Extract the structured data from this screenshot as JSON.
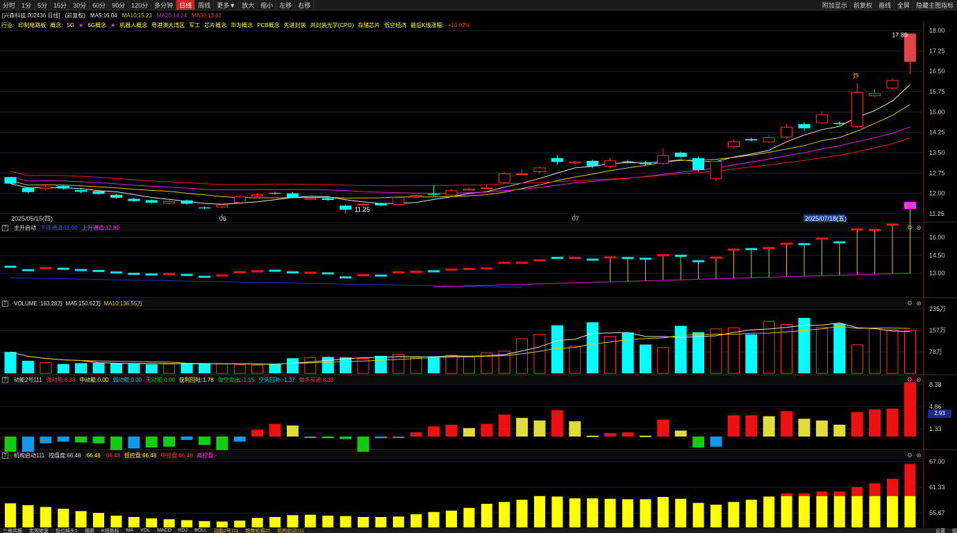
{
  "toolbar": {
    "periods": [
      "分时",
      "1分",
      "5分",
      "15分",
      "30分",
      "60分",
      "90分",
      "120分",
      "多分钟",
      "日线",
      "周线",
      "更多▼",
      "放大",
      "缩小",
      "左移",
      "右移"
    ],
    "active_period": "日线",
    "right_buttons": [
      "附加显示",
      "前复权",
      "画线",
      "全屏",
      "隐藏主图指标"
    ]
  },
  "header": {
    "stock": "[兴森科技 002436 日线]",
    "adjust": "(前复权)",
    "ma5": "MA5:16.04",
    "ma10": "MA10:15.23",
    "ma20": "MA20:14.24",
    "ma30": "MA30:13.61"
  },
  "concepts": {
    "prefix": "行业:",
    "items": [
      {
        "text": "印制电路板",
        "star": false
      },
      {
        "text": "概念:",
        "star": false
      },
      {
        "text": "5G",
        "star": true
      },
      {
        "text": "6G概念",
        "star": true
      },
      {
        "text": "机器人概念",
        "star": false
      },
      {
        "text": "粤港澳大湾区",
        "star": false
      },
      {
        "text": "军工",
        "star": false
      },
      {
        "text": "芯片概念",
        "star": false
      },
      {
        "text": "华为概念",
        "star": false
      },
      {
        "text": "PCB概念",
        "star": false
      },
      {
        "text": "先进封装",
        "star": false
      },
      {
        "text": "共封装光学(CPO)",
        "star": false
      },
      {
        "text": "存储芯片",
        "star": false
      },
      {
        "text": "低空经济",
        "star": false
      },
      {
        "text": "最后K线涨幅:",
        "star": false
      }
    ],
    "last_change": "+10.02%"
  },
  "colors": {
    "up": "#ff3333",
    "down": "#00ffff",
    "ma5": "#e6e6e6",
    "ma10": "#e6c41e",
    "ma20": "#dd22dd",
    "ma30": "#dd1f1f",
    "grid": "#1f1f3a",
    "axis": "#8a1f1f"
  },
  "main_chart": {
    "high_label": "17.89",
    "low_label": "11.25",
    "marker": "炸",
    "y_ticks": [
      "18.00",
      "17.25",
      "16.50",
      "15.75",
      "15.00",
      "14.25",
      "13.50",
      "12.75",
      "12.00",
      "11.25"
    ],
    "x_labels": [
      "2025/05/15(四)",
      "06",
      "07",
      "2025/07/18(五)"
    ],
    "candles": [
      [
        12.6,
        12.36,
        12.36,
        12.6
      ],
      [
        12.2,
        12.05,
        12.22,
        12.0
      ],
      [
        12.18,
        12.24,
        12.3,
        12.12
      ],
      [
        12.27,
        12.18,
        12.3,
        12.12
      ],
      [
        12.12,
        12.06,
        12.2,
        12.0
      ],
      [
        12.08,
        11.98,
        12.1,
        11.95
      ],
      [
        11.95,
        11.84,
        11.98,
        11.8
      ],
      [
        11.8,
        11.72,
        11.84,
        11.68
      ],
      [
        11.75,
        11.66,
        11.78,
        11.62
      ],
      [
        11.64,
        11.7,
        11.74,
        11.6
      ],
      [
        11.74,
        11.62,
        11.78,
        11.58
      ],
      [
        11.48,
        11.45,
        11.52,
        11.42
      ],
      [
        11.5,
        11.57,
        11.62,
        11.46
      ],
      [
        11.66,
        11.87,
        11.92,
        11.6
      ],
      [
        11.9,
        11.95,
        12.02,
        11.86
      ],
      [
        12.02,
        12.0,
        12.06,
        11.95
      ],
      [
        12.0,
        11.85,
        12.05,
        11.82
      ],
      [
        11.78,
        11.82,
        11.86,
        11.74
      ],
      [
        11.82,
        11.76,
        11.86,
        11.72
      ],
      [
        11.55,
        11.4,
        11.58,
        11.25
      ],
      [
        11.58,
        11.6,
        11.64,
        11.5
      ],
      [
        11.64,
        11.56,
        11.66,
        11.52
      ],
      [
        11.6,
        11.85,
        11.88,
        11.56
      ],
      [
        11.88,
        11.92,
        11.96,
        11.84
      ],
      [
        11.98,
        11.95,
        12.3,
        11.9
      ],
      [
        11.94,
        12.1,
        12.18,
        11.9
      ],
      [
        12.12,
        12.16,
        12.2,
        12.08
      ],
      [
        12.2,
        12.2,
        12.3,
        12.15
      ],
      [
        12.4,
        12.72,
        12.8,
        12.35
      ],
      [
        12.72,
        12.72,
        12.9,
        12.7
      ],
      [
        12.8,
        12.94,
        13.0,
        12.75
      ],
      [
        13.3,
        13.16,
        13.42,
        13.05
      ],
      [
        13.12,
        13.16,
        13.2,
        13.05
      ],
      [
        13.2,
        13.0,
        13.24,
        12.92
      ],
      [
        13.0,
        13.2,
        13.3,
        12.92
      ],
      [
        13.18,
        13.15,
        13.24,
        13.1
      ],
      [
        13.14,
        13.08,
        13.2,
        13.02
      ],
      [
        13.1,
        13.4,
        13.65,
        13.05
      ],
      [
        13.5,
        13.35,
        13.54,
        13.3
      ],
      [
        13.3,
        12.86,
        13.35,
        12.8
      ],
      [
        12.55,
        13.18,
        13.2,
        12.45
      ],
      [
        13.72,
        13.9,
        13.98,
        13.66
      ],
      [
        14.0,
        13.95,
        14.06,
        13.9
      ],
      [
        13.9,
        14.05,
        14.15,
        13.85
      ],
      [
        14.08,
        14.44,
        14.56,
        14.02
      ],
      [
        14.55,
        14.4,
        14.62,
        14.3
      ],
      [
        14.6,
        14.9,
        15.02,
        14.55
      ],
      [
        14.6,
        14.56,
        14.66,
        14.52
      ],
      [
        14.46,
        15.72,
        16.06,
        14.4
      ],
      [
        15.6,
        15.68,
        15.86,
        15.55
      ],
      [
        15.88,
        16.16,
        16.24,
        15.84
      ],
      [
        16.85,
        17.89,
        17.89,
        16.4
      ]
    ]
  },
  "panel_zhusheng": {
    "title": "主升启动",
    "legend1": "下降通道:11.00",
    "legend2": "上升通道:12.80",
    "y_ticks": [
      "16.00",
      "14.50",
      "13.00"
    ]
  },
  "panel_volume": {
    "title": "VOLUME",
    "vol": ":163.28万",
    "ma5": "MA5:150.62万",
    "ma10": "MA10:136.55万",
    "y_ticks": [
      "235万",
      "157万",
      "78万"
    ],
    "bars": [
      78,
      46,
      39,
      34,
      37,
      38,
      37,
      35,
      33,
      34,
      36,
      37,
      34,
      31,
      30,
      35,
      55,
      57,
      60,
      58,
      54,
      64,
      69,
      58,
      60,
      66,
      60,
      74,
      81,
      126,
      142,
      175,
      99,
      186,
      135,
      149,
      105,
      94,
      173,
      150,
      162,
      166,
      142,
      189,
      178,
      202,
      167,
      181,
      104,
      162,
      158,
      157
    ]
  },
  "panel_dongneng": {
    "title": "动能2号111",
    "legends": [
      {
        "t": "强动能:8.38",
        "c": "#ff3333"
      },
      {
        "t": "中动能:0.00",
        "c": "#ffff33"
      },
      {
        "t": "弱动能:0.00",
        "c": "#00ccff"
      },
      {
        "t": "无动能:0.00",
        "c": "#00cc00"
      },
      {
        "t": "获利回吐:1.78",
        "c": "#ffff33"
      },
      {
        "t": "做空卖出:-1.55",
        "c": "#00cc00"
      },
      {
        "t": "空头回补:-1.37",
        "c": "#00ccff"
      },
      {
        "t": "做多买进:8.38",
        "c": "#ff3333"
      }
    ],
    "y_ticks": [
      "8.38",
      "4.86",
      "1.33"
    ],
    "selected_value": "2.93",
    "bars": [
      [
        -1.8,
        "g"
      ],
      [
        -1.8,
        "b"
      ],
      [
        -0.8,
        "b"
      ],
      [
        -0.6,
        "b"
      ],
      [
        -0.7,
        "g"
      ],
      [
        -0.8,
        "g"
      ],
      [
        -1.6,
        "g"
      ],
      [
        -1.4,
        "b"
      ],
      [
        -1.3,
        "g"
      ],
      [
        -1.2,
        "g"
      ],
      [
        -0.4,
        "b"
      ],
      [
        -1.0,
        "g"
      ],
      [
        -1.6,
        "g"
      ],
      [
        -0.6,
        "b"
      ],
      [
        0.8,
        "r"
      ],
      [
        1.5,
        "r"
      ],
      [
        1.3,
        "y"
      ],
      [
        -0.1,
        "g"
      ],
      [
        -0.2,
        "g"
      ],
      [
        -0.3,
        "g"
      ],
      [
        -1.8,
        "g"
      ],
      [
        -0.2,
        "b"
      ],
      [
        -0.1,
        "b"
      ],
      [
        0.5,
        "r"
      ],
      [
        1.2,
        "r"
      ],
      [
        1.4,
        "r"
      ],
      [
        1.0,
        "y"
      ],
      [
        1.5,
        "r"
      ],
      [
        2.6,
        "r"
      ],
      [
        2.2,
        "y"
      ],
      [
        1.9,
        "y"
      ],
      [
        3.1,
        "r"
      ],
      [
        1.8,
        "y"
      ],
      [
        0.1,
        "y"
      ],
      [
        0.4,
        "r"
      ],
      [
        0.5,
        "r"
      ],
      [
        0.1,
        "y"
      ],
      [
        2.0,
        "r"
      ],
      [
        0.7,
        "y"
      ],
      [
        -1.3,
        "g"
      ],
      [
        -1.2,
        "b"
      ],
      [
        2.5,
        "r"
      ],
      [
        2.5,
        "r"
      ],
      [
        2.4,
        "y"
      ],
      [
        3.0,
        "r"
      ],
      [
        2.1,
        "y"
      ],
      [
        1.9,
        "y"
      ],
      [
        1.4,
        "y"
      ],
      [
        2.9,
        "r"
      ],
      [
        3.2,
        "r"
      ],
      [
        3.3,
        "r"
      ],
      [
        6.4,
        "r"
      ]
    ]
  },
  "panel_jigou": {
    "title": "机构启动111",
    "legends": [
      {
        "t": "控盘度:66.48",
        "c": "#dddddd"
      },
      {
        "t": ":66.48",
        "c": "#ffff33"
      },
      {
        "t": ":66.48",
        "c": "#ff3333"
      },
      {
        "t": "低控盘:66.48",
        "c": "#ffff33"
      },
      {
        "t": "中控盘:66.48",
        "c": "#ff3333"
      },
      {
        "t": "高控盘:-",
        "c": "#ff33ff"
      }
    ],
    "y_ticks": [
      "67.00",
      "61.33",
      "55.67"
    ],
    "bars": [
      [
        57.8,
        0
      ],
      [
        57.4,
        0
      ],
      [
        57.0,
        0
      ],
      [
        56.6,
        0
      ],
      [
        56.1,
        0
      ],
      [
        55.7,
        0
      ],
      [
        55.1,
        0
      ],
      [
        54.8,
        0
      ],
      [
        54.5,
        0
      ],
      [
        54.3,
        0
      ],
      [
        54.1,
        0
      ],
      [
        53.9,
        0
      ],
      [
        53.8,
        0
      ],
      [
        54.0,
        0
      ],
      [
        54.6,
        0
      ],
      [
        54.8,
        0
      ],
      [
        55.2,
        0
      ],
      [
        55.3,
        0
      ],
      [
        55.1,
        0
      ],
      [
        55.0,
        0
      ],
      [
        54.8,
        0
      ],
      [
        54.8,
        0
      ],
      [
        54.9,
        0
      ],
      [
        55.4,
        0
      ],
      [
        55.9,
        0
      ],
      [
        56.2,
        0
      ],
      [
        56.8,
        0
      ],
      [
        57.7,
        0
      ],
      [
        58.1,
        0
      ],
      [
        58.6,
        0
      ],
      [
        59.4,
        0
      ],
      [
        59.3,
        0
      ],
      [
        58.9,
        0
      ],
      [
        58.9,
        0
      ],
      [
        58.8,
        0
      ],
      [
        58.7,
        0
      ],
      [
        58.7,
        0
      ],
      [
        59.2,
        0
      ],
      [
        58.8,
        0
      ],
      [
        57.9,
        0
      ],
      [
        57.5,
        0
      ],
      [
        58.1,
        0
      ],
      [
        58.6,
        0
      ],
      [
        59.3,
        0
      ],
      [
        59.4,
        1
      ],
      [
        59.4,
        1
      ],
      [
        59.4,
        1
      ],
      [
        59.4,
        1
      ],
      [
        59.4,
        1
      ],
      [
        59.4,
        1
      ],
      [
        59.4,
        1
      ],
      [
        59.4,
        1
      ]
    ],
    "bar_tops": [
      57.8,
      57.4,
      57.0,
      56.6,
      56.1,
      55.7,
      55.1,
      54.8,
      54.5,
      54.3,
      54.1,
      53.9,
      53.8,
      54.0,
      54.6,
      54.8,
      55.2,
      55.3,
      55.1,
      55.0,
      54.8,
      54.8,
      54.9,
      55.4,
      55.9,
      56.2,
      56.8,
      57.7,
      58.1,
      58.6,
      59.4,
      59.3,
      58.9,
      58.9,
      58.8,
      58.7,
      58.7,
      59.2,
      58.8,
      57.9,
      57.5,
      58.1,
      58.6,
      59.3,
      60.0,
      60.0,
      60.4,
      60.4,
      61.4,
      62.2,
      63.2,
      66.48
    ]
  },
  "bottombar": {
    "items": [
      "三维共振",
      "宏观修复",
      "低位掉头1",
      "摆脱",
      "K线指标",
      "MA",
      "VOL",
      "MACD",
      "KDJ",
      "BOLL",
      "动能2号111",
      "趋势轮廓22",
      "机构启动111"
    ],
    "right": [
      "设置",
      "组"
    ]
  }
}
